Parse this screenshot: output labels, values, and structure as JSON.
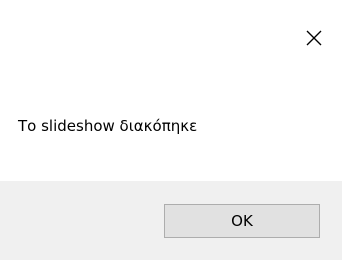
{
  "dialog": {
    "message": "Το slideshow διακόπηκε",
    "ok_label": "OK"
  },
  "icons": {
    "close": "close-icon"
  },
  "colors": {
    "background": "#ffffff",
    "footer": "#f0f0f0",
    "button_face": "#e1e1e1",
    "button_border": "#adadad",
    "text": "#000000"
  }
}
